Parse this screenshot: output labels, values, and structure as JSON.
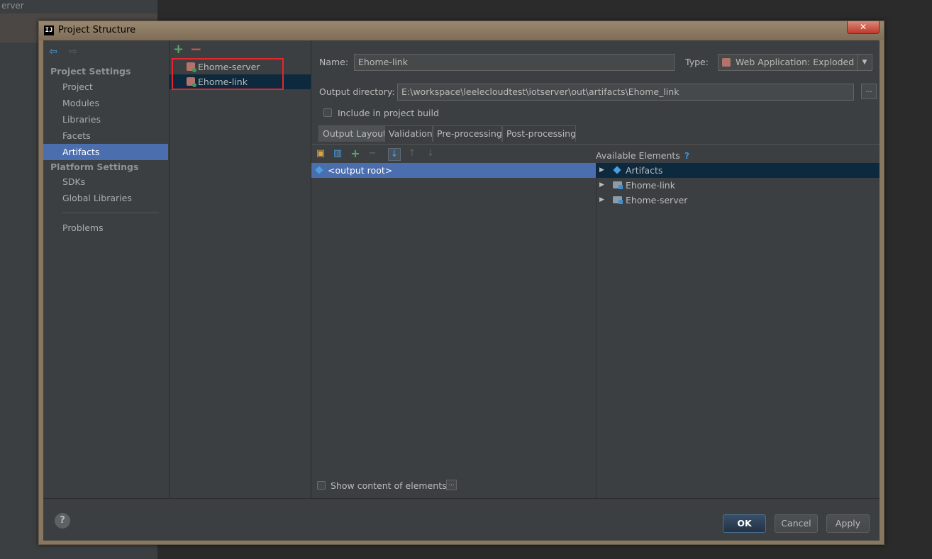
{
  "background_app": {
    "sidebar_text": "erver"
  },
  "dialog": {
    "title": "Project Structure",
    "close_glyph": "✕",
    "title_icon": "IJ"
  },
  "sidebar": {
    "back_glyph": "⇦",
    "forward_glyph": "⇨",
    "project_settings_header": "Project Settings",
    "project_items": [
      "Project",
      "Modules",
      "Libraries",
      "Facets",
      "Artifacts"
    ],
    "platform_settings_header": "Platform Settings",
    "platform_items": [
      "SDKs",
      "Global Libraries"
    ],
    "problems": "Problems",
    "active": "Artifacts"
  },
  "artifacts": {
    "add_glyph": "+",
    "remove_glyph": "−",
    "items": [
      "Ehome-server",
      "Ehome-link"
    ],
    "selected": "Ehome-link"
  },
  "form": {
    "name_label": "Name:",
    "name_value": "Ehome-link",
    "type_label": "Type:",
    "type_value": "Web Application: Exploded",
    "output_dir_label": "Output directory:",
    "output_dir_value": "E:\\workspace\\leelecloudtest\\iotserver\\out\\artifacts\\Ehome_link",
    "browse_glyph": "...",
    "include_build_label": "Include in project build"
  },
  "tabs": [
    "Output Layout",
    "Validation",
    "Pre-processing",
    "Post-processing"
  ],
  "active_tab": "Output Layout",
  "layout": {
    "output_root": "<output root>",
    "available_title": "Available Elements",
    "help_glyph": "?",
    "available_items": [
      "Artifacts",
      "Ehome-link",
      "Ehome-server"
    ],
    "show_content_label": "Show content of elements",
    "show_content_browse": "..."
  },
  "footer": {
    "help_glyph": "?",
    "ok": "OK",
    "cancel": "Cancel",
    "apply": "Apply"
  },
  "colors": {
    "accent": "#4b6eaf",
    "selection_dark": "#0d293e",
    "highlight_box": "#e5262b",
    "panel_bg": "#3c3f41"
  }
}
